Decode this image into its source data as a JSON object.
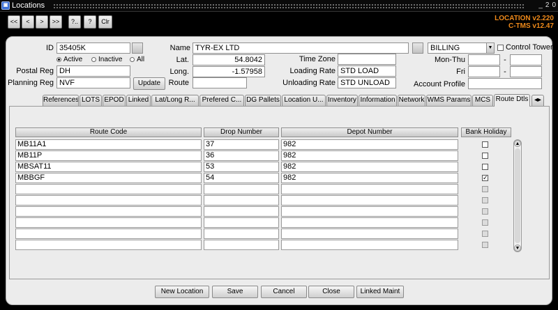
{
  "window": {
    "title": "Locations",
    "app_icon": "app-icon",
    "controls": [
      "_",
      "2",
      "0"
    ]
  },
  "toolbar": {
    "buttons": [
      {
        "label": "<<",
        "name": "first-record-button"
      },
      {
        "label": "<",
        "name": "prev-record-button"
      },
      {
        "label": ">",
        "name": "next-record-button"
      },
      {
        "label": ">>",
        "name": "last-record-button"
      },
      {
        "label": "?..",
        "name": "query-button"
      },
      {
        "label": "?",
        "name": "help-button"
      },
      {
        "label": "Clr",
        "name": "clear-button"
      }
    ],
    "version_line1": "LOCATION v2.220",
    "version_line2": "C-TMS v12.47",
    "version_color": "#f08a1a"
  },
  "header": {
    "id_label": "ID",
    "id_value": "35405K",
    "status": {
      "active": "Active",
      "inactive": "Inactive",
      "all": "All",
      "selected": "active"
    },
    "postal_reg_label": "Postal Reg",
    "postal_reg_value": "DH",
    "planning_reg_label": "Planning Reg",
    "planning_reg_value": "NVF",
    "update_label": "Update",
    "name_label": "Name",
    "name_value": "TYR-EX LTD",
    "lat_label": "Lat.",
    "lat_value": "54.8042",
    "long_label": "Long.",
    "long_value": "-1.57958",
    "route_label": "Route",
    "route_value": "",
    "time_zone_label": "Time Zone",
    "time_zone_value": "",
    "loading_rate_label": "Loading Rate",
    "loading_rate_value": "STD LOAD",
    "unloading_rate_label": "Unloading Rate",
    "unloading_rate_value": "STD UNLOAD",
    "billing_value": "BILLING",
    "control_tower_label": "Control Tower",
    "control_tower_checked": false,
    "mon_thu_label": "Mon-Thu",
    "fri_label": "Fri",
    "dash": "-",
    "account_profile_label": "Account Profile",
    "account_profile_value": ""
  },
  "tabs": [
    "References",
    "LOTS",
    "EPOD",
    "Linked",
    "Lat/Long R...",
    "Prefered C...",
    "DG Pallets",
    "Location U...",
    "Inventory",
    "Information",
    "Network",
    "WMS Params",
    "MCS",
    "Route Dtls"
  ],
  "active_tab": "Route Dtls",
  "route_table": {
    "headers": {
      "route_code": "Route Code",
      "drop_number": "Drop Number",
      "depot_number": "Depot Number",
      "bank_holiday": "Bank Holiday"
    },
    "rows": [
      {
        "route_code": "MB11A1",
        "drop_number": "37",
        "depot_number": "982",
        "bank_holiday": false
      },
      {
        "route_code": "MB11P",
        "drop_number": "36",
        "depot_number": "982",
        "bank_holiday": false
      },
      {
        "route_code": "MBSAT11",
        "drop_number": "53",
        "depot_number": "982",
        "bank_holiday": false
      },
      {
        "route_code": "MBBGF",
        "drop_number": "54",
        "depot_number": "982",
        "bank_holiday": true
      },
      {
        "route_code": "",
        "drop_number": "",
        "depot_number": "",
        "bank_holiday": null
      },
      {
        "route_code": "",
        "drop_number": "",
        "depot_number": "",
        "bank_holiday": null
      },
      {
        "route_code": "",
        "drop_number": "",
        "depot_number": "",
        "bank_holiday": null
      },
      {
        "route_code": "",
        "drop_number": "",
        "depot_number": "",
        "bank_holiday": null
      },
      {
        "route_code": "",
        "drop_number": "",
        "depot_number": "",
        "bank_holiday": null
      },
      {
        "route_code": "",
        "drop_number": "",
        "depot_number": "",
        "bank_holiday": null
      }
    ]
  },
  "footer": {
    "new_location": "New Location",
    "save": "Save",
    "cancel": "Cancel",
    "close": "Close",
    "linked_maint": "Linked Maint"
  }
}
